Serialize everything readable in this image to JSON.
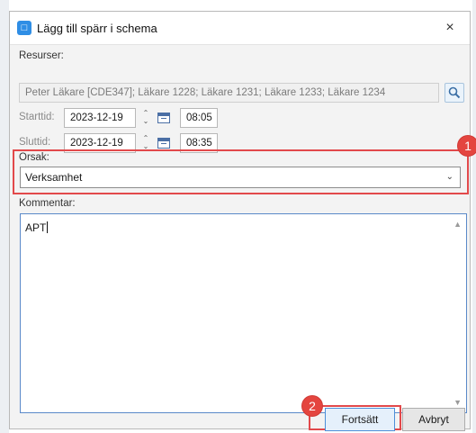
{
  "dialog": {
    "title": "Lägg till spärr i schema",
    "close_glyph": "×",
    "icon": "calendar-app-icon"
  },
  "resources": {
    "label": "Resurser:",
    "value": "Peter Läkare [CDE347]; Läkare 1228; Läkare 1231; Läkare 1233; Läkare 1234",
    "search_icon": "magnifier-icon"
  },
  "start": {
    "label": "Starttid:",
    "date": "2023-12-19",
    "time": "08:05"
  },
  "end": {
    "label": "Sluttid:",
    "date": "2023-12-19",
    "time": "08:35"
  },
  "reason": {
    "label": "Orsak:",
    "value": "Verksamhet"
  },
  "comment": {
    "label": "Kommentar:",
    "value": "APT"
  },
  "buttons": {
    "continue": "Fortsätt",
    "cancel": "Avbryt"
  },
  "annotations": {
    "badge1": "1",
    "badge2": "2",
    "highlight_color": "#e2494b"
  }
}
